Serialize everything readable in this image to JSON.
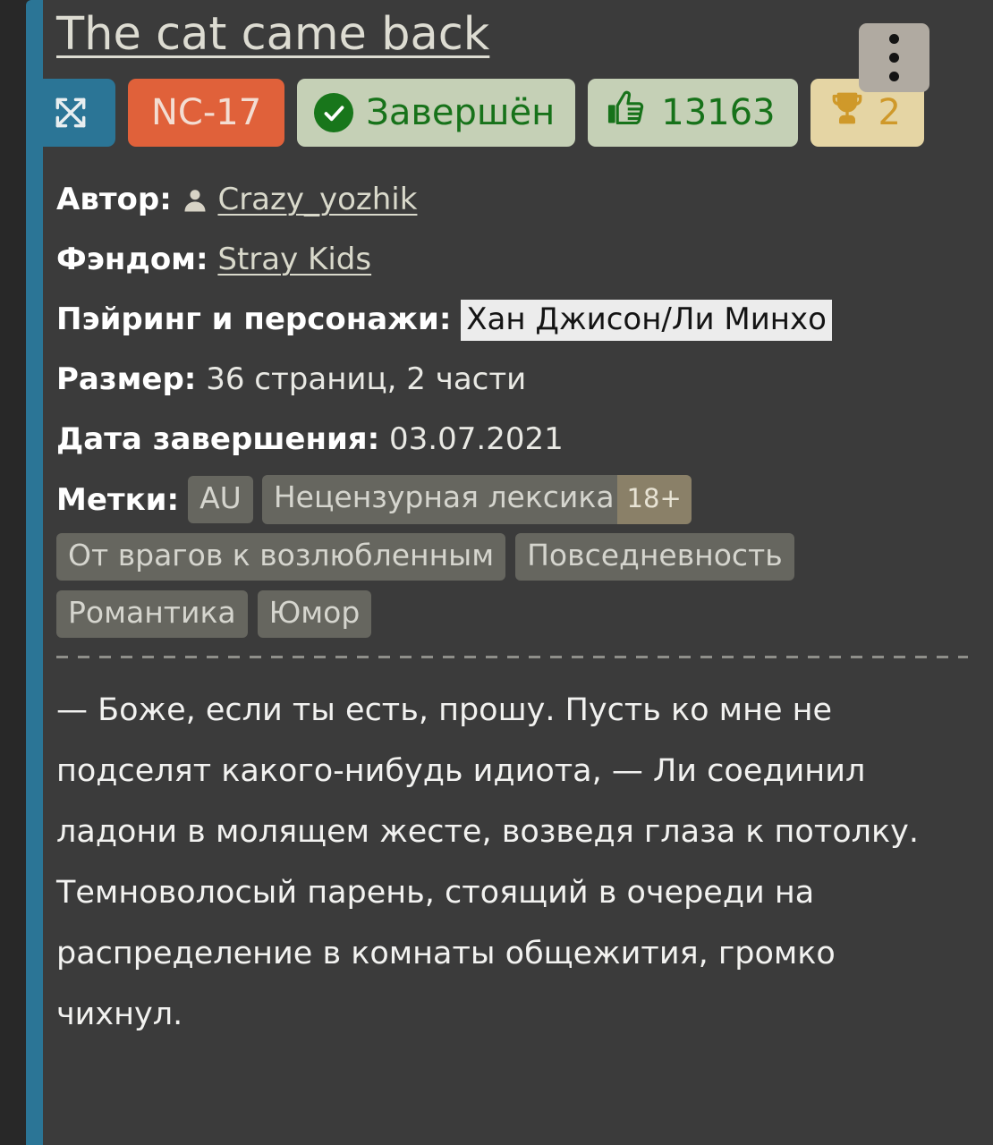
{
  "story": {
    "title": "The cat came back",
    "menu_button_label": "⋮"
  },
  "badges": {
    "slash_icon_label": "crossed-arrows",
    "rating": "NC-17",
    "status": "Завершён",
    "likes": "13163",
    "awards": "2"
  },
  "meta": {
    "author_label": "Автор:",
    "author_name": "Crazy_yozhik",
    "fandom_label": "Фэндом:",
    "fandom_value": "Stray Kids",
    "pairing_label": "Пэйринг и персонажи:",
    "pairing_value": "Хан Джисон/Ли Минхо",
    "size_label": "Размер:",
    "size_value": "36 страниц, 2 части",
    "finish_date_label": "Дата завершения:",
    "finish_date_value": "03.07.2021"
  },
  "tags": {
    "label": "Метки:",
    "first": "AU",
    "second": "Нецензурная лексика",
    "adult_marker": "18+",
    "rest": [
      "От врагов к возлюбленным",
      "Повседневность",
      "Романтика",
      "Юмор"
    ]
  },
  "body": {
    "excerpt": "— Боже, если ты есть, прошу. Пусть ко мне не подселят какого-нибудь идиота, — Ли соединил ладони в молящем жесте, возведя глаза к потолку. Темноволосый парень, стоящий в очереди на распределение в комнаты общежития, громко чихнул."
  },
  "colors": {
    "accent_teal": "#2b7596",
    "card_bg": "#3b3b3b",
    "page_bg": "#282828",
    "rating_orange": "#e0613a",
    "status_green_bg": "#c5d0b6",
    "status_green_fg": "#17721a",
    "awards_tan_bg": "#e5d5a4",
    "awards_gold_fg": "#cf992a",
    "tag_gray": "#66665f",
    "adult_tan": "#8a8068"
  }
}
